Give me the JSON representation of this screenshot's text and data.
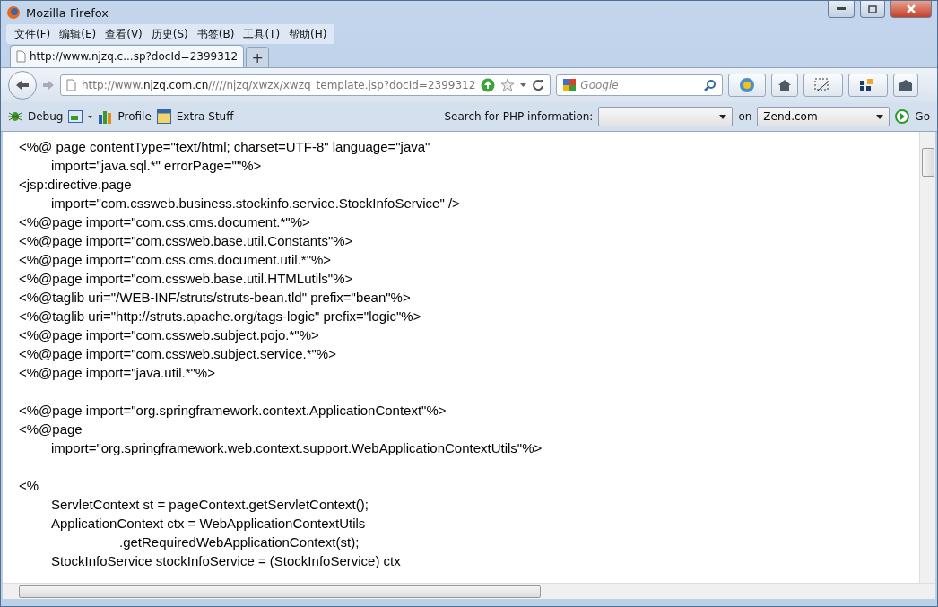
{
  "window": {
    "title": "Mozilla Firefox"
  },
  "menu": [
    "文件(F)",
    "编辑(E)",
    "查看(V)",
    "历史(S)",
    "书签(B)",
    "工具(T)",
    "帮助(H)"
  ],
  "tabs": [
    {
      "label": "http://www.njzq.c...sp?docId=2399312",
      "selected": true
    }
  ],
  "new_tab": "+",
  "address": {
    "host_prefix": "http://www.",
    "host": "njzq.com.cn",
    "path": "/////njzq/xwzx/xwzq_template.jsp?docId=2399312"
  },
  "search": {
    "placeholder": "Google"
  },
  "toolbar": {
    "items": [
      {
        "label": "Debug"
      },
      {
        "label": "Profile"
      },
      {
        "label": "Extra Stuff"
      }
    ],
    "search_label": "Search for PHP information:",
    "on_label": "on",
    "site": "Zend.com",
    "go": "Go"
  },
  "code_lines": [
    {
      "kind": "line",
      "text": "<%@ page contentType=\"text/html; charset=UTF-8\" language=\"java\""
    },
    {
      "kind": "cont",
      "text": "import=\"java.sql.*\" errorPage=\"\"%>"
    },
    {
      "kind": "line",
      "text": "<jsp:directive.page"
    },
    {
      "kind": "cont",
      "text": "import=\"com.cssweb.business.stockinfo.service.StockInfoService\" />"
    },
    {
      "kind": "line",
      "text": "<%@page import=\"com.css.cms.document.*\"%>"
    },
    {
      "kind": "line",
      "text": "<%@page import=\"com.cssweb.base.util.Constants\"%>"
    },
    {
      "kind": "line",
      "text": "<%@page import=\"com.css.cms.document.util.*\"%>"
    },
    {
      "kind": "line",
      "text": "<%@page import=\"com.cssweb.base.util.HTMLutils\"%>"
    },
    {
      "kind": "line",
      "text": "<%@taglib uri=\"/WEB-INF/struts/struts-bean.tld\" prefix=\"bean\"%>"
    },
    {
      "kind": "line",
      "text": "<%@taglib uri=\"http://struts.apache.org/tags-logic\" prefix=\"logic\"%>"
    },
    {
      "kind": "line",
      "text": "<%@page import=\"com.cssweb.subject.pojo.*\"%>"
    },
    {
      "kind": "line",
      "text": "<%@page import=\"com.cssweb.subject.service.*\"%>"
    },
    {
      "kind": "line",
      "text": "<%@page import=\"java.util.*\"%>"
    },
    {
      "kind": "blank"
    },
    {
      "kind": "line",
      "text": "<%@page import=\"org.springframework.context.ApplicationContext\"%>"
    },
    {
      "kind": "line",
      "text": "<%@page"
    },
    {
      "kind": "cont",
      "text": "import=\"org.springframework.web.context.support.WebApplicationContextUtils\"%>"
    },
    {
      "kind": "blank"
    },
    {
      "kind": "line",
      "text": "<%"
    },
    {
      "kind": "cont",
      "text": "ServletContext st = pageContext.getServletContext();"
    },
    {
      "kind": "cont",
      "text": "ApplicationContext ctx = WebApplicationContextUtils"
    },
    {
      "kind": "cont2",
      "text": ".getRequiredWebApplicationContext(st);"
    },
    {
      "kind": "cont",
      "text": "StockInfoService stockInfoService = (StockInfoService) ctx"
    }
  ]
}
